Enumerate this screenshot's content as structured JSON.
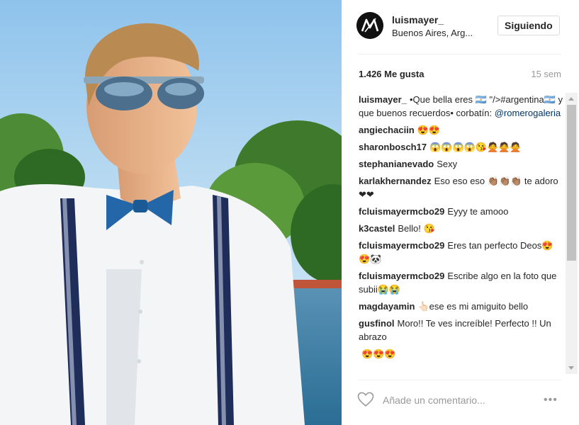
{
  "post": {
    "username": "luismayer_",
    "location": "Buenos Aires, Arg...",
    "follow_label": "Siguiendo",
    "likes": "1.426 Me gusta",
    "age": "15 sem"
  },
  "comments": [
    {
      "user": "luismayer_",
      "text": "•Que bella eres 🇦🇷 \"/>#argentina🇦🇷 y que buenos recuerdos• corbatín: ",
      "mention": "@romerogaleria"
    },
    {
      "user": "angiechaciin",
      "text": "😍😍",
      "mention": ""
    },
    {
      "user": "sharonbosch17",
      "text": "😱😱😱😱😘🙅🙅🙅",
      "mention": ""
    },
    {
      "user": "stephanianevado",
      "text": "Sexy",
      "mention": ""
    },
    {
      "user": "karlakhernandez",
      "text": "Eso eso eso 👏🏽👏🏽👏🏽 te adoro❤❤",
      "mention": ""
    },
    {
      "user": "fcluismayermcbo29",
      "text": "Eyyy te amooo",
      "mention": ""
    },
    {
      "user": "k3castel",
      "text": "Bello! 😘",
      "mention": ""
    },
    {
      "user": "fcluismayermcbo29",
      "text": "Eres tan perfecto Deos😍😍🐼",
      "mention": ""
    },
    {
      "user": "fcluismayermcbo29",
      "text": "Escribe algo en la foto que subii😭😭",
      "mention": ""
    },
    {
      "user": "magdayamin",
      "text": "👆🏻ese es mi amiguito bello",
      "mention": ""
    },
    {
      "user": "gusfinol",
      "text": "Moro!! Te ves increíble! Perfecto !! Un abrazo",
      "mention": ""
    },
    {
      "user": "",
      "text": "😍😍😍",
      "mention": ""
    }
  ],
  "add_comment": {
    "placeholder": "Añade un comentario...",
    "more": "•••"
  },
  "icons": {
    "heart": "heart-outline-icon",
    "more": "more-options-icon",
    "avatar": "lm-logo"
  },
  "colors": {
    "mention": "#003569",
    "muted": "#999999",
    "border": "#dbdbdb"
  }
}
